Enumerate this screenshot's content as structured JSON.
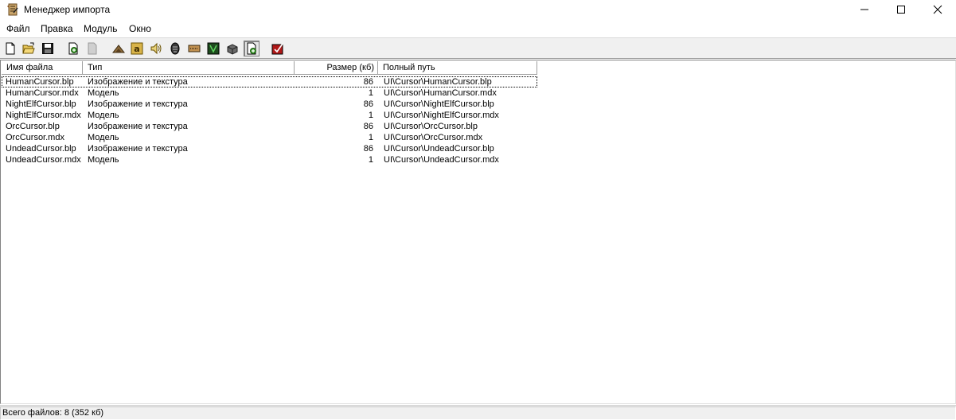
{
  "window": {
    "title": "Менеджер импорта"
  },
  "menu": {
    "items": [
      {
        "label": "Файл"
      },
      {
        "label": "Правка"
      },
      {
        "label": "Модуль"
      },
      {
        "label": "Окно"
      }
    ]
  },
  "toolbar": {
    "buttons": [
      {
        "icon": "new-file-icon"
      },
      {
        "icon": "open-folder-icon"
      },
      {
        "icon": "save-icon"
      },
      {
        "icon": "import-file-icon"
      },
      {
        "icon": "export-file-icon",
        "disabled": true
      },
      {
        "icon": "terrain-editor-icon"
      },
      {
        "icon": "unit-editor-icon"
      },
      {
        "icon": "sound-editor-icon"
      },
      {
        "icon": "object-editor-icon"
      },
      {
        "icon": "campaign-editor-icon"
      },
      {
        "icon": "ai-editor-icon"
      },
      {
        "icon": "object-manager-icon"
      },
      {
        "icon": "import-manager-icon",
        "pressed": true
      },
      {
        "icon": "test-map-icon"
      }
    ]
  },
  "list": {
    "columns": [
      "Имя файла",
      "Тип",
      "Размер (кб)",
      "Полный путь"
    ],
    "rows": [
      {
        "name": "HumanCursor.blp",
        "type": "Изображение и текстура",
        "size": "86",
        "path": "UI\\Cursor\\HumanCursor.blp"
      },
      {
        "name": "HumanCursor.mdx",
        "type": "Модель",
        "size": "1",
        "path": "UI\\Cursor\\HumanCursor.mdx"
      },
      {
        "name": "NightElfCursor.blp",
        "type": "Изображение и текстура",
        "size": "86",
        "path": "UI\\Cursor\\NightElfCursor.blp"
      },
      {
        "name": "NightElfCursor.mdx",
        "type": "Модель",
        "size": "1",
        "path": "UI\\Cursor\\NightElfCursor.mdx"
      },
      {
        "name": "OrcCursor.blp",
        "type": "Изображение и текстура",
        "size": "86",
        "path": "UI\\Cursor\\OrcCursor.blp"
      },
      {
        "name": "OrcCursor.mdx",
        "type": "Модель",
        "size": "1",
        "path": "UI\\Cursor\\OrcCursor.mdx"
      },
      {
        "name": "UndeadCursor.blp",
        "type": "Изображение и текстура",
        "size": "86",
        "path": "UI\\Cursor\\UndeadCursor.blp"
      },
      {
        "name": "UndeadCursor.mdx",
        "type": "Модель",
        "size": "1",
        "path": "UI\\Cursor\\UndeadCursor.mdx"
      }
    ]
  },
  "status": {
    "text": "Всего файлов: 8 (352 кб)"
  }
}
